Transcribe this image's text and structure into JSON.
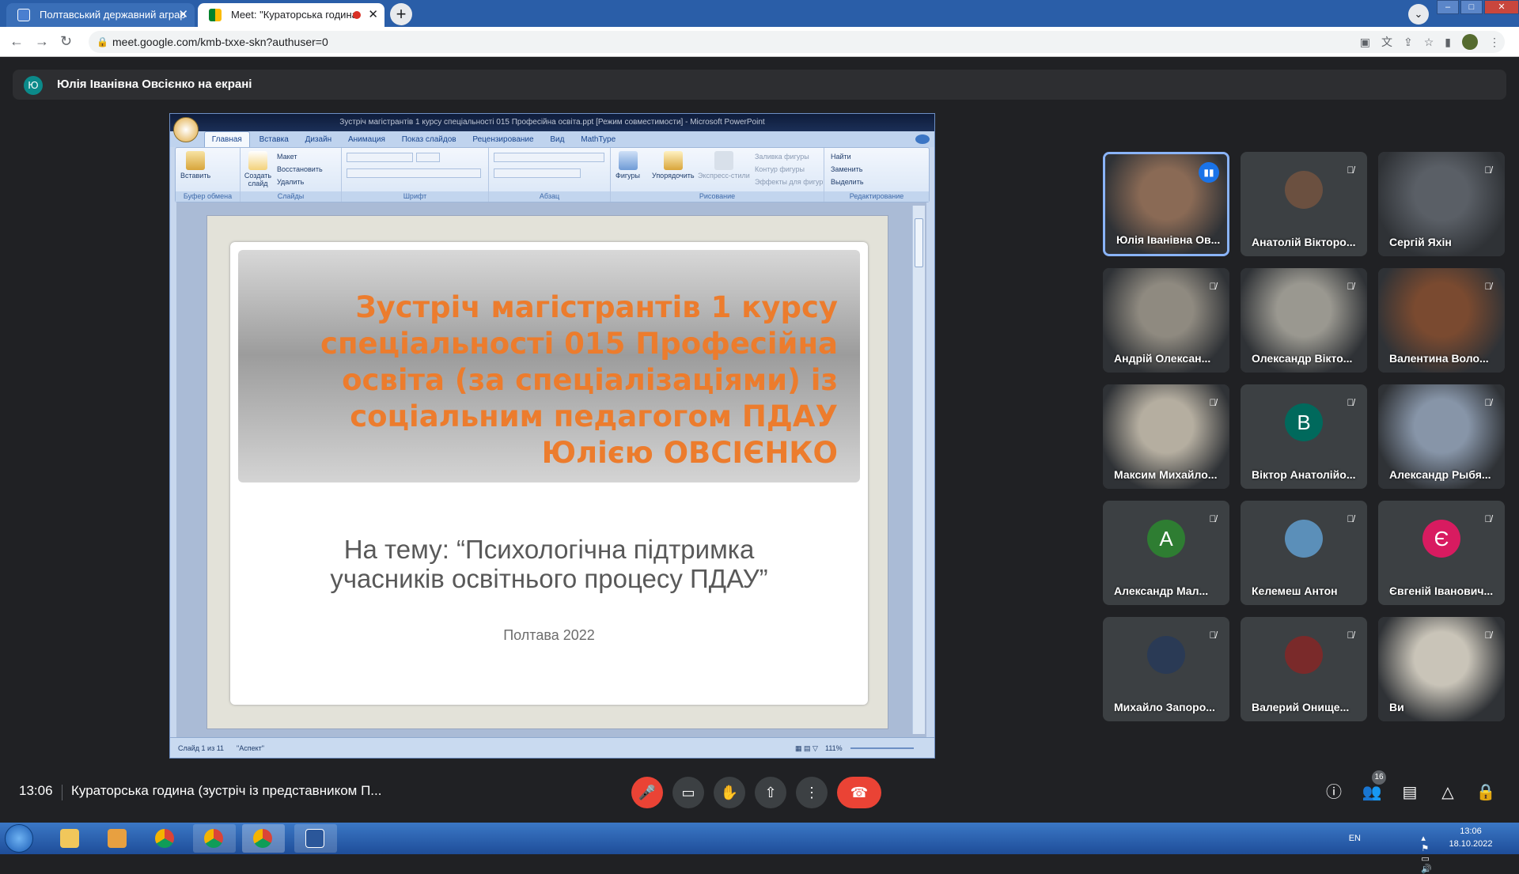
{
  "browser": {
    "tabs": [
      {
        "title": "Полтавський державний аграр",
        "active": false
      },
      {
        "title": "Meet: \"Кураторська година",
        "active": true
      }
    ],
    "url": "meet.google.com/kmb-txxe-skn?authuser=0"
  },
  "banner": {
    "initial": "Ю",
    "text": "Юлія Іванівна Овсієнко на екрані"
  },
  "ppt": {
    "window_title": "Зустріч магістрантів 1 курсу спеціальності 015 Професійна освіта.ppt [Режим совместимости] - Microsoft PowerPoint",
    "tabs": [
      "Главная",
      "Вставка",
      "Дизайн",
      "Анимация",
      "Показ слайдов",
      "Рецензирование",
      "Вид",
      "MathType"
    ],
    "groups": {
      "clipboard": "Буфер обмена",
      "slides": "Слайды",
      "font": "Шрифт",
      "paragraph": "Абзац",
      "drawing": "Рисование",
      "editing": "Редактирование"
    },
    "buttons": {
      "paste": "Вставить",
      "new_slide": "Создать слайд",
      "layout": "Макет",
      "reset": "Восстановить",
      "delete": "Удалить",
      "shapes": "Фигуры",
      "arrange": "Упорядочить",
      "quick_styles": "Экспресс-стили",
      "fill": "Заливка фигуры",
      "outline": "Контур фигуры",
      "effects": "Эффекты для фигур",
      "find": "Найти",
      "replace": "Заменить",
      "select": "Выделить"
    },
    "slide": {
      "title": "Зустріч магістрантів 1 курсу\nспеціальності 015 Професійна\nосвіта (за спеціалізаціями) із\nсоціальним педагогом ПДАУ\nЮлією ОВСІЄНКО",
      "subtitle": "На тему: “Психологічна підтримка\nучасників освітнього процесу ПДАУ”",
      "city": "Полтава 2022"
    },
    "status": {
      "slide": "Слайд 1 из 11",
      "theme": "\"Аспект\"",
      "zoom": "111%"
    }
  },
  "participants": [
    {
      "name": "Юлія Іванівна Ов...",
      "type": "photo",
      "color": "#8a6a55",
      "speaking": true,
      "muted": false
    },
    {
      "name": "Анатолій Вікторо...",
      "type": "avatar-photo",
      "color": "#6b5040",
      "muted": true
    },
    {
      "name": "Сергій Яхін",
      "type": "photo",
      "color": "#5a5f66",
      "muted": true
    },
    {
      "name": "Андрій Олексан...",
      "type": "photo",
      "color": "#8f8a80",
      "muted": true
    },
    {
      "name": "Олександр Вікто...",
      "type": "photo",
      "color": "#9a9890",
      "muted": true
    },
    {
      "name": "Валентина Воло...",
      "type": "photo",
      "color": "#7a4a30",
      "muted": true
    },
    {
      "name": "Максим Михайло...",
      "type": "photo",
      "color": "#b5aea0",
      "muted": true
    },
    {
      "name": "Віктор Анатолійо...",
      "type": "letter",
      "letter": "В",
      "color": "#00695c",
      "muted": true
    },
    {
      "name": "Александр Рыбя...",
      "type": "photo",
      "color": "#8795a8",
      "muted": true
    },
    {
      "name": "Александр Мал...",
      "type": "letter",
      "letter": "А",
      "color": "#2e7d32",
      "muted": true
    },
    {
      "name": "Келемеш Антон",
      "type": "avatar-photo",
      "color": "#5b8fb9",
      "muted": true
    },
    {
      "name": "Євгеній Іванович...",
      "type": "letter",
      "letter": "Є",
      "color": "#d81b60",
      "muted": true
    },
    {
      "name": "Михайло Запоро...",
      "type": "avatar-photo",
      "color": "#2a3a55",
      "muted": true
    },
    {
      "name": "Валерий Онище...",
      "type": "avatar-photo",
      "color": "#7a2a2a",
      "muted": true
    },
    {
      "name": "Ви",
      "type": "photo",
      "color": "#c9c4b8",
      "muted": true
    }
  ],
  "bottom": {
    "time": "13:06",
    "meeting": "Кураторська година (зустріч із представником П...",
    "people_count": "16"
  },
  "taskbar": {
    "lang": "EN",
    "time": "13:06",
    "date": "18.10.2022"
  }
}
